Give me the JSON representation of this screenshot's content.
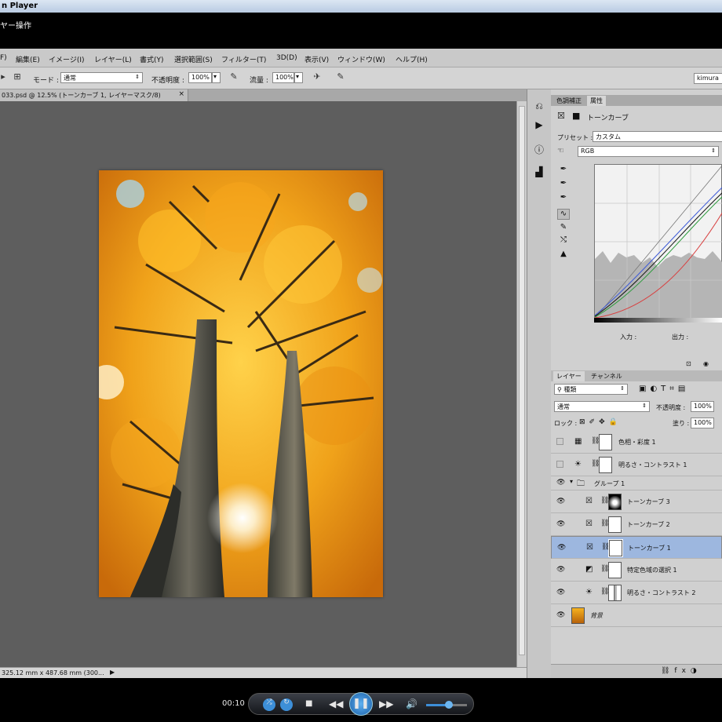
{
  "window": {
    "title": "n Player",
    "menu_text": "ヤー操作"
  },
  "menubar": {
    "items": [
      "F)",
      "編集(E)",
      "イメージ(I)",
      "レイヤー(L)",
      "書式(Y)",
      "選択範囲(S)",
      "フィルター(T)",
      "3D(D)",
      "表示(V)",
      "ウィンドウ(W)",
      "ヘルプ(H)"
    ]
  },
  "options": {
    "mode_label": "モード :",
    "mode_value": "通常",
    "opacity_label": "不透明度 :",
    "opacity_value": "100%",
    "flow_label": "流量 :",
    "flow_value": "100%",
    "workspace": "kimura"
  },
  "document": {
    "tab_title": "033.psd @ 12.5% (トーンカーブ 1, レイヤーマスク/8)",
    "close": "×",
    "status": "325.12 mm x 487.68 mm (300...",
    "status_arrow": "▶"
  },
  "properties_panel": {
    "tabs": [
      "色調補正",
      "属性"
    ],
    "title": "トーンカーブ",
    "preset_label": "プリセット :",
    "preset_value": "カスタム",
    "channel_value": "RGB",
    "input_label": "入力 :",
    "output_label": "出力 :"
  },
  "layers_panel": {
    "tabs": [
      "レイヤー",
      "チャンネル"
    ],
    "filter_value": "種類",
    "blend_value": "通常",
    "opacity_label": "不透明度 :",
    "opacity_value": "100%",
    "lock_label": "ロック :",
    "fill_label": "塗り :",
    "fill_value": "100%",
    "layers": [
      {
        "name": "色相・彩度 1",
        "visible": false,
        "type": "adjustment",
        "icon": "hue-saturation-icon"
      },
      {
        "name": "明るさ・コントラスト 1",
        "visible": false,
        "type": "adjustment",
        "icon": "brightness-icon"
      },
      {
        "name": "グループ 1",
        "visible": true,
        "type": "group",
        "icon": "folder-icon"
      },
      {
        "name": "トーンカーブ 3",
        "visible": true,
        "type": "adjustment",
        "icon": "curves-icon"
      },
      {
        "name": "トーンカーブ 2",
        "visible": true,
        "type": "adjustment",
        "icon": "curves-icon"
      },
      {
        "name": "トーンカーブ 1",
        "visible": true,
        "type": "adjustment",
        "icon": "curves-icon",
        "selected": true
      },
      {
        "name": "特定色域の選択 1",
        "visible": true,
        "type": "adjustment",
        "icon": "selective-color-icon"
      },
      {
        "name": "明るさ・コントラスト 2",
        "visible": true,
        "type": "adjustment",
        "icon": "brightness-icon"
      },
      {
        "name": "背景",
        "visible": true,
        "type": "image",
        "icon": "background-thumb"
      }
    ]
  },
  "player": {
    "time": "00:10",
    "state": "playing",
    "volume_fraction": 0.55
  },
  "colors": {
    "selected_layer": "#9db7df",
    "canvas_bg": "#5e5e5e",
    "accent": "#3d8fd8"
  }
}
